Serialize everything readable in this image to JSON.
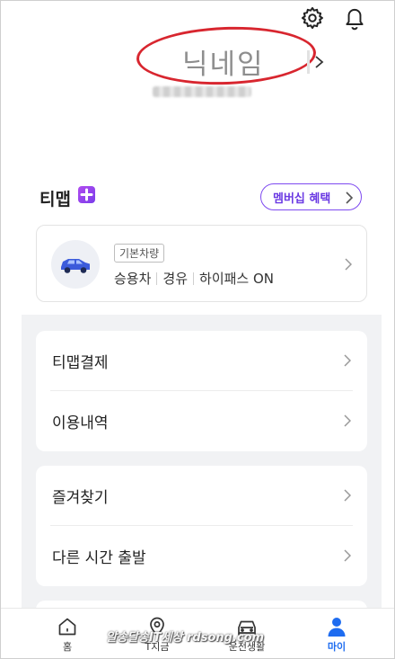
{
  "header": {
    "settings_icon": "gear-icon",
    "notifications_icon": "bell-icon"
  },
  "profile": {
    "nickname": "닉네임",
    "phone_masked": "blurred-phone-number"
  },
  "tmap": {
    "title": "티맵",
    "plus_badge": "plus-icon",
    "membership_button": "멤버십 혜택"
  },
  "vehicle": {
    "default_badge": "기본차량",
    "type": "승용차",
    "fuel": "경유",
    "hipass": "하이패스 ON",
    "car_color": "#3b5bdb"
  },
  "menu": {
    "group1": [
      "티맵결제",
      "이용내역"
    ],
    "group2": [
      "즐겨찾기",
      "다른 시간 출발"
    ]
  },
  "nav": {
    "home": "홈",
    "now": "T지금",
    "drive": "운전생활",
    "my": "마이",
    "active": "마이",
    "active_color": "#1e6cf0"
  },
  "watermark": "알송달송IT세상 rdsong.com",
  "colors": {
    "accent_purple": "#7e4af0",
    "annotation_red": "#d8262f",
    "section_gray": "#f1f2f4"
  }
}
